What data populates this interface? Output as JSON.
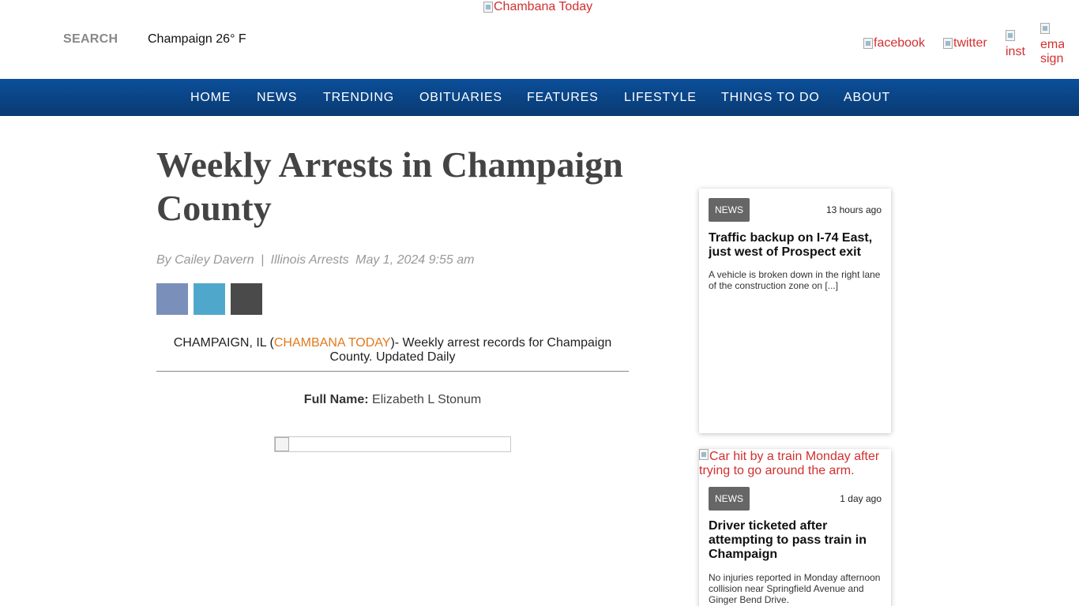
{
  "header": {
    "logo_alt": "Chambana Today",
    "search_label": "SEARCH",
    "weather": "Champaign  26° F",
    "social": {
      "facebook": "facebook",
      "twitter": "twitter",
      "instagram": "inst",
      "email_line1": "ema",
      "email_line2": "sign"
    }
  },
  "nav": {
    "items": [
      "HOME",
      "NEWS",
      "TRENDING",
      "OBITUARIES",
      "FEATURES",
      "LIFESTYLE",
      "THINGS TO DO",
      "ABOUT"
    ]
  },
  "article": {
    "title": "Weekly Arrests in Champaign County",
    "author": "By Cailey Davern",
    "separator": "|",
    "category": "Illinois Arrests",
    "date": "May 1, 2024 9:55 am",
    "share_colors": {
      "facebook": "#7b8fbb",
      "twitter": "#4fa8cb",
      "email": "#4a4a4a"
    },
    "lead_prefix": "CHAMPAIGN, IL (",
    "lead_source": "CHAMBANA TODAY",
    "lead_suffix": ")- Weekly arrest records for Champaign County. Updated Daily",
    "fullname_label": "Full Name:",
    "fullname_value": "Elizabeth L Stonum"
  },
  "sidebar": {
    "cards": [
      {
        "badge": "NEWS",
        "time": "13 hours ago",
        "title": "Traffic backup on I-74 East, just west of Prospect exit",
        "excerpt": "A vehicle is broken down in the right lane of the construction zone on [...]"
      },
      {
        "image_alt": "Car hit by a train Monday after trying to go around the arm.",
        "badge": "NEWS",
        "time": "1 day ago",
        "title": "Driver ticketed after attempting to pass train in Champaign",
        "excerpt": "No injuries reported in Monday afternoon collision near Springfield Avenue and Ginger Bend Drive."
      }
    ]
  },
  "colors": {
    "nav_bg": "#0a4486",
    "link_red": "#d32f2f",
    "source_orange": "#e07a1c",
    "badge_bg": "#666666"
  }
}
